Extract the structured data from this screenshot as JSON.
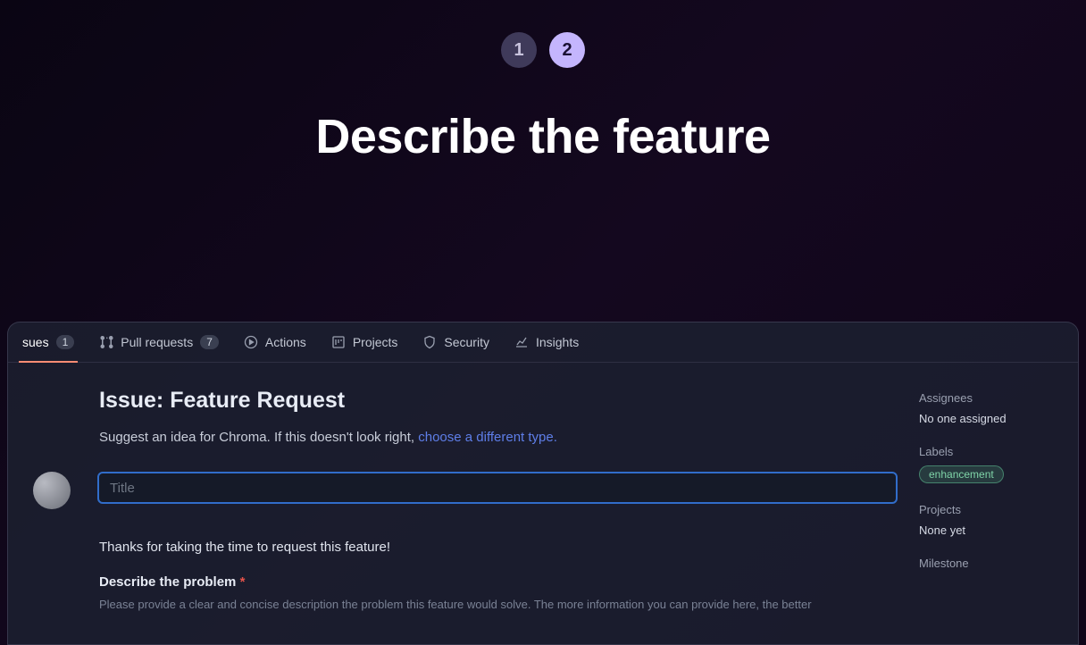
{
  "steps": {
    "step1": "1",
    "step2": "2"
  },
  "hero": {
    "title": "Describe the feature"
  },
  "tabs": {
    "issues": {
      "label": "sues",
      "count": "1"
    },
    "pulls": {
      "label": "Pull requests",
      "count": "7"
    },
    "actions": {
      "label": "Actions"
    },
    "projects": {
      "label": "Projects"
    },
    "security": {
      "label": "Security"
    },
    "insights": {
      "label": "Insights"
    }
  },
  "issue": {
    "heading": "Issue: Feature Request",
    "subtitle_prefix": "Suggest an idea for Chroma. If this doesn't look right, ",
    "subtitle_link": "choose a different type.",
    "title_placeholder": "Title",
    "thanks": "Thanks for taking the time to request this feature!",
    "problem_label": "Describe the problem",
    "required_mark": "*",
    "problem_hint": "Please provide a clear and concise description the problem this feature would solve. The more information you can provide here, the better"
  },
  "sidebar": {
    "assignees_label": "Assignees",
    "assignees_value": "No one assigned",
    "labels_label": "Labels",
    "labels_chip": "enhancement",
    "projects_label": "Projects",
    "projects_value": "None yet",
    "milestone_label": "Milestone"
  }
}
